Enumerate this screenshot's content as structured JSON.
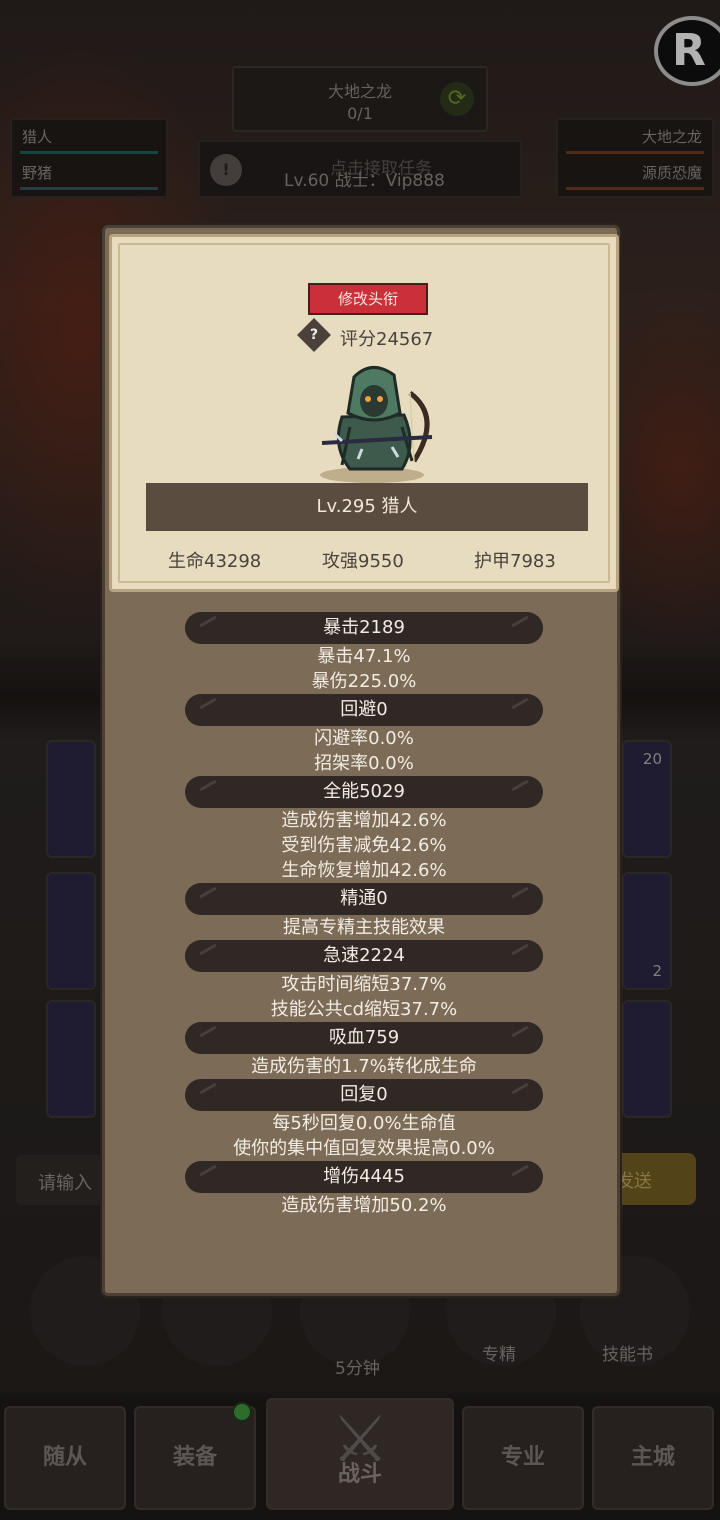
{
  "background": {
    "boss_name": "大地之龙",
    "boss_progress": "0/1",
    "party_left": [
      "猎人",
      "野猪"
    ],
    "party_right": [
      "大地之龙",
      "源质恐魔"
    ],
    "quest_hint": "点击接取任务",
    "player_line": "Lv.60 战士：Vip888",
    "chat_placeholder": "请输入",
    "send_label": "发送",
    "slot_counts": [
      "20",
      "2"
    ],
    "round_buttons": {
      "timer": "5分钟",
      "specialty": "专精",
      "skillbook": "技能书"
    },
    "nav": [
      "随从",
      "装备",
      "战斗",
      "专业",
      "主城"
    ]
  },
  "modal": {
    "rename_label": "修改头衔",
    "score": "评分24567",
    "level_class": "Lv.295 猎人",
    "core_stats": {
      "hp": "生命43298",
      "atk": "攻强9550",
      "armor": "护甲7983"
    },
    "stats": [
      {
        "header": "暴击2189",
        "lines": [
          "暴击47.1%",
          "暴伤225.0%"
        ]
      },
      {
        "header": "回避0",
        "lines": [
          "闪避率0.0%",
          "招架率0.0%"
        ]
      },
      {
        "header": "全能5029",
        "lines": [
          "造成伤害增加42.6%",
          "受到伤害减免42.6%",
          "生命恢复增加42.6%"
        ]
      },
      {
        "header": "精通0",
        "lines": [
          "提高专精主技能效果"
        ]
      },
      {
        "header": "急速2224",
        "lines": [
          "攻击时间缩短37.7%",
          "技能公共cd缩短37.7%"
        ]
      },
      {
        "header": "吸血759",
        "lines": [
          "造成伤害的1.7%转化成生命"
        ]
      },
      {
        "header": "回复0",
        "lines": [
          "每5秒回复0.0%生命值",
          "使你的集中值回复效果提高0.0%"
        ]
      },
      {
        "header": "增伤4445",
        "lines": [
          "造成伤害增加50.2%"
        ]
      }
    ]
  },
  "icons": [
    "refresh-icon",
    "alert-icon",
    "help-icon",
    "crossed-swords-icon",
    "hero-portrait"
  ],
  "colors": {
    "rename_button": "#c9303a",
    "parchment": "#e8dcc0",
    "panel": "#7b6b57",
    "stat_header": "#2f2824"
  }
}
